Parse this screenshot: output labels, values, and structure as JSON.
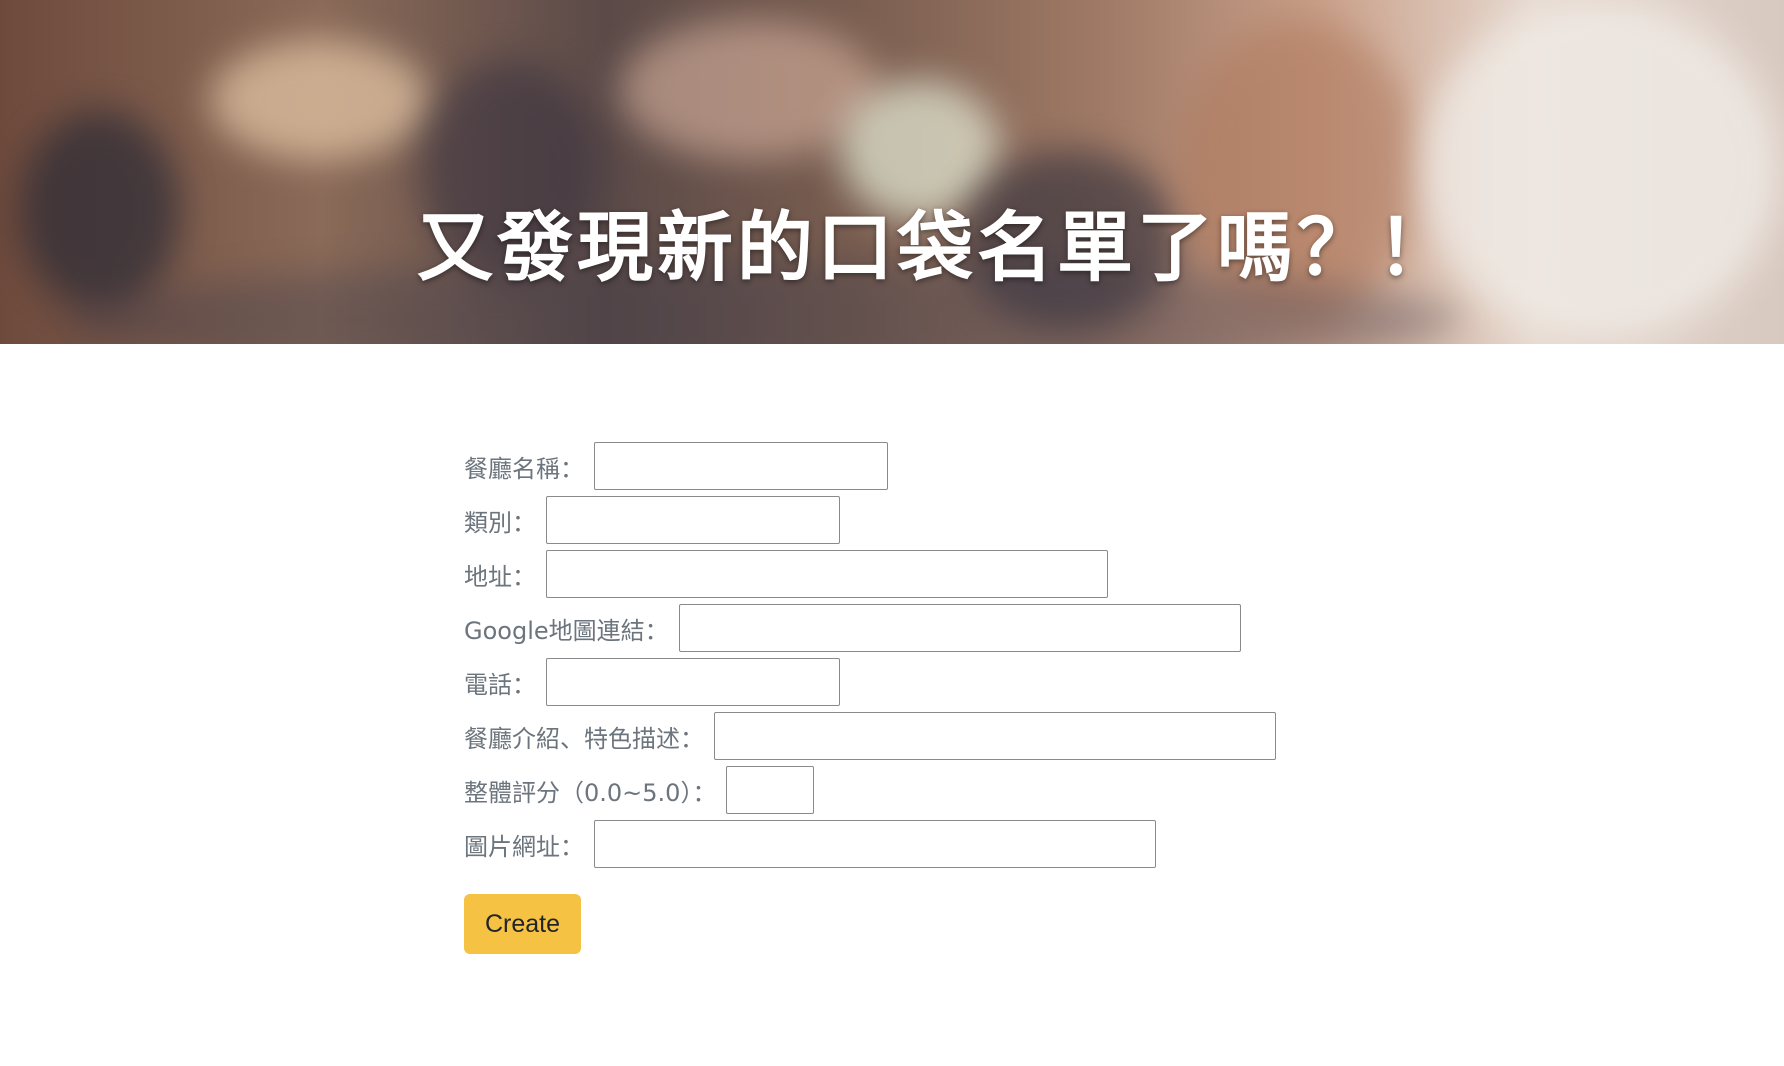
{
  "banner": {
    "title": "又發現新的口袋名單了嗎？！"
  },
  "form": {
    "fields": [
      {
        "label": "餐廳名稱：",
        "value": ""
      },
      {
        "label": "類別：",
        "value": ""
      },
      {
        "label": "地址：",
        "value": ""
      },
      {
        "label": "Google地圖連結：",
        "value": ""
      },
      {
        "label": "電話：",
        "value": ""
      },
      {
        "label": "餐廳介紹、特色描述：",
        "value": ""
      },
      {
        "label": "整體評分（0.0~5.0）：",
        "value": ""
      },
      {
        "label": "圖片網址：",
        "value": ""
      }
    ],
    "submit_label": "Create"
  },
  "colors": {
    "label": "#6c757d",
    "button_bg": "#f6c244",
    "button_text": "#212529"
  }
}
